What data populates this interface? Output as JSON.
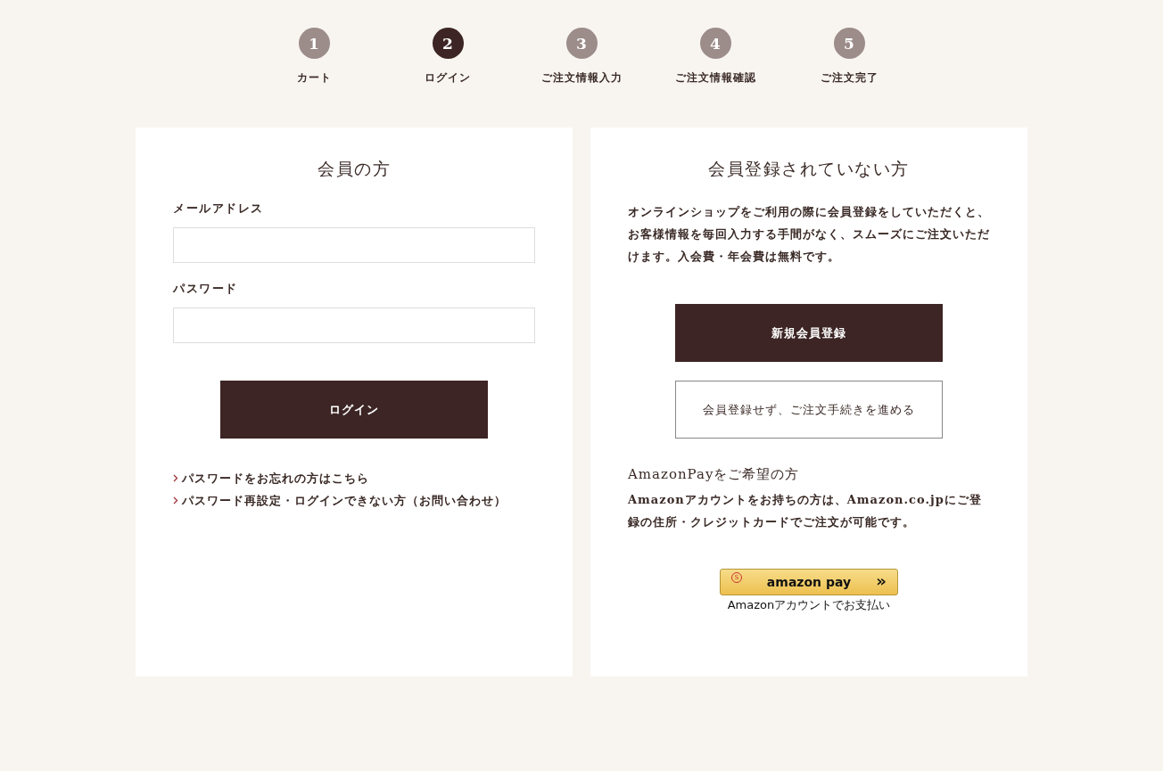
{
  "steps": [
    {
      "number": "1",
      "label": "カート",
      "selected": false
    },
    {
      "number": "2",
      "label": "ログイン",
      "selected": true
    },
    {
      "number": "3",
      "label": "ご注文情報入力",
      "selected": false
    },
    {
      "number": "4",
      "label": "ご注文情報確認",
      "selected": false
    },
    {
      "number": "5",
      "label": "ご注文完了",
      "selected": false
    }
  ],
  "member": {
    "title": "会員の方",
    "fields": [
      {
        "label": "メールアドレス"
      },
      {
        "label": "パスワード"
      }
    ],
    "login_button": "ログイン",
    "links": [
      "パスワードをお忘れの方はこちら",
      "パスワード再設定・ログインできない方（お問い合わせ）"
    ]
  },
  "guest": {
    "title": "会員登録されていない方",
    "description": "オンラインショップをご利用の際に会員登録をしていただくと、お客様情報を毎回入力する手間がなく、スムーズにご注文いただけます。入会費・年会費は無料です。",
    "register_button": "新規会員登録",
    "guest_button": "会員登録せず、ご注文手続きを進める",
    "amazon_title": "AmazonPayをご希望の方",
    "amazon_description": "Amazonアカウントをお持ちの方は、Amazon.co.jpにご登録の住所・クレジットカードでご注文が可能です。",
    "amazon_button": {
      "badge": "S",
      "logo": "amazon pay",
      "arrows": "»",
      "caption": "Amazonアカウントでお支払い"
    }
  }
}
